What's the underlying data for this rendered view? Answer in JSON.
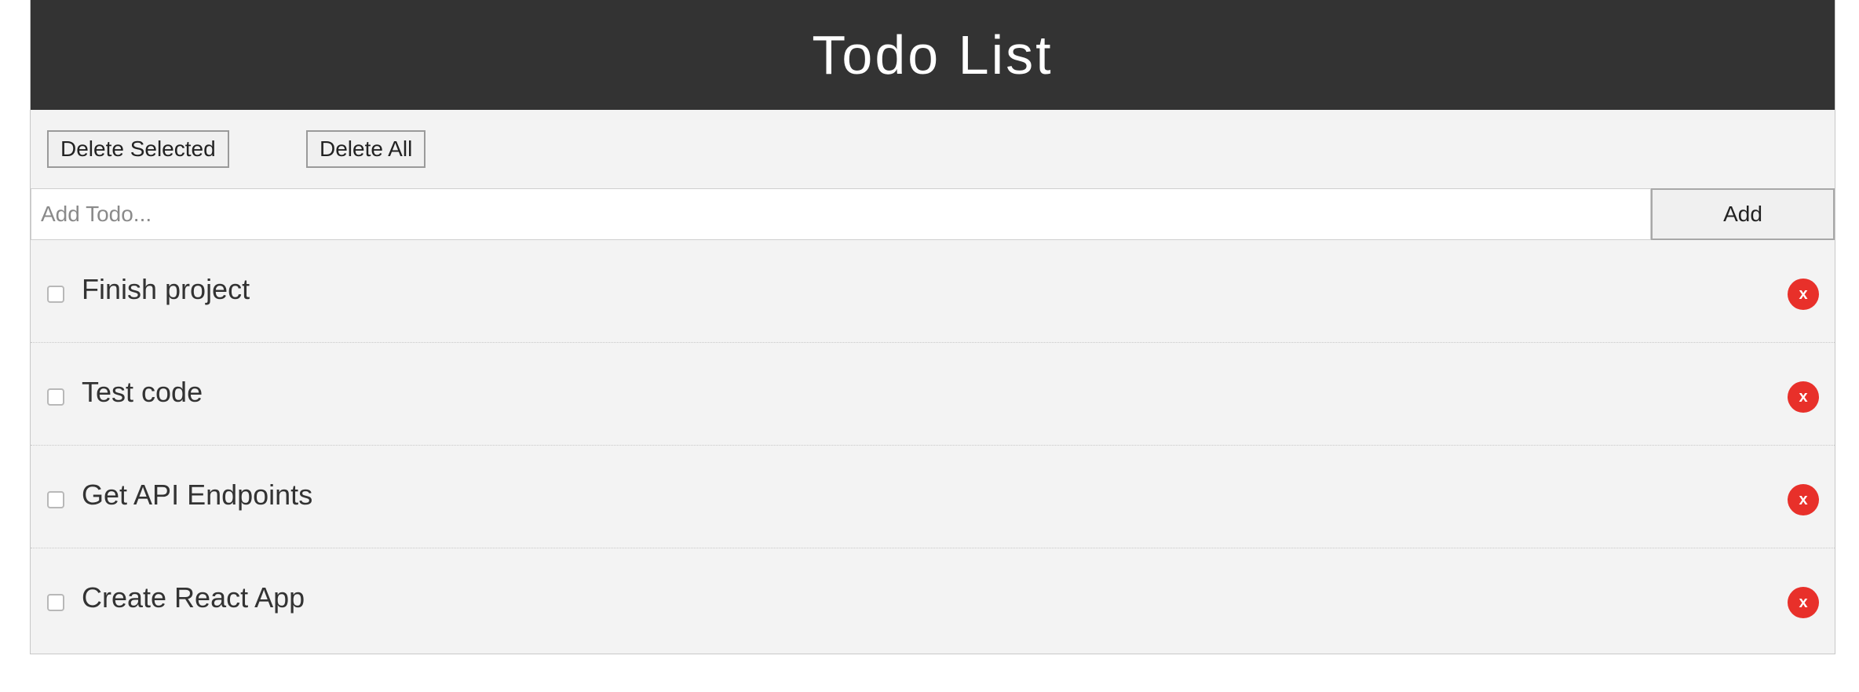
{
  "header": {
    "title": "Todo List"
  },
  "toolbar": {
    "delete_selected_label": "Delete Selected",
    "delete_all_label": "Delete All"
  },
  "add_form": {
    "placeholder": "Add Todo...",
    "value": "",
    "add_label": "Add"
  },
  "todos": [
    {
      "text": "Finish project",
      "checked": false,
      "delete_label": "x"
    },
    {
      "text": "Test code",
      "checked": false,
      "delete_label": "x"
    },
    {
      "text": "Get API Endpoints",
      "checked": false,
      "delete_label": "x"
    },
    {
      "text": "Create React App",
      "checked": false,
      "delete_label": "x"
    }
  ],
  "colors": {
    "header_bg": "#333333",
    "panel_bg": "#f3f3f3",
    "delete_button": "#e8302a"
  }
}
